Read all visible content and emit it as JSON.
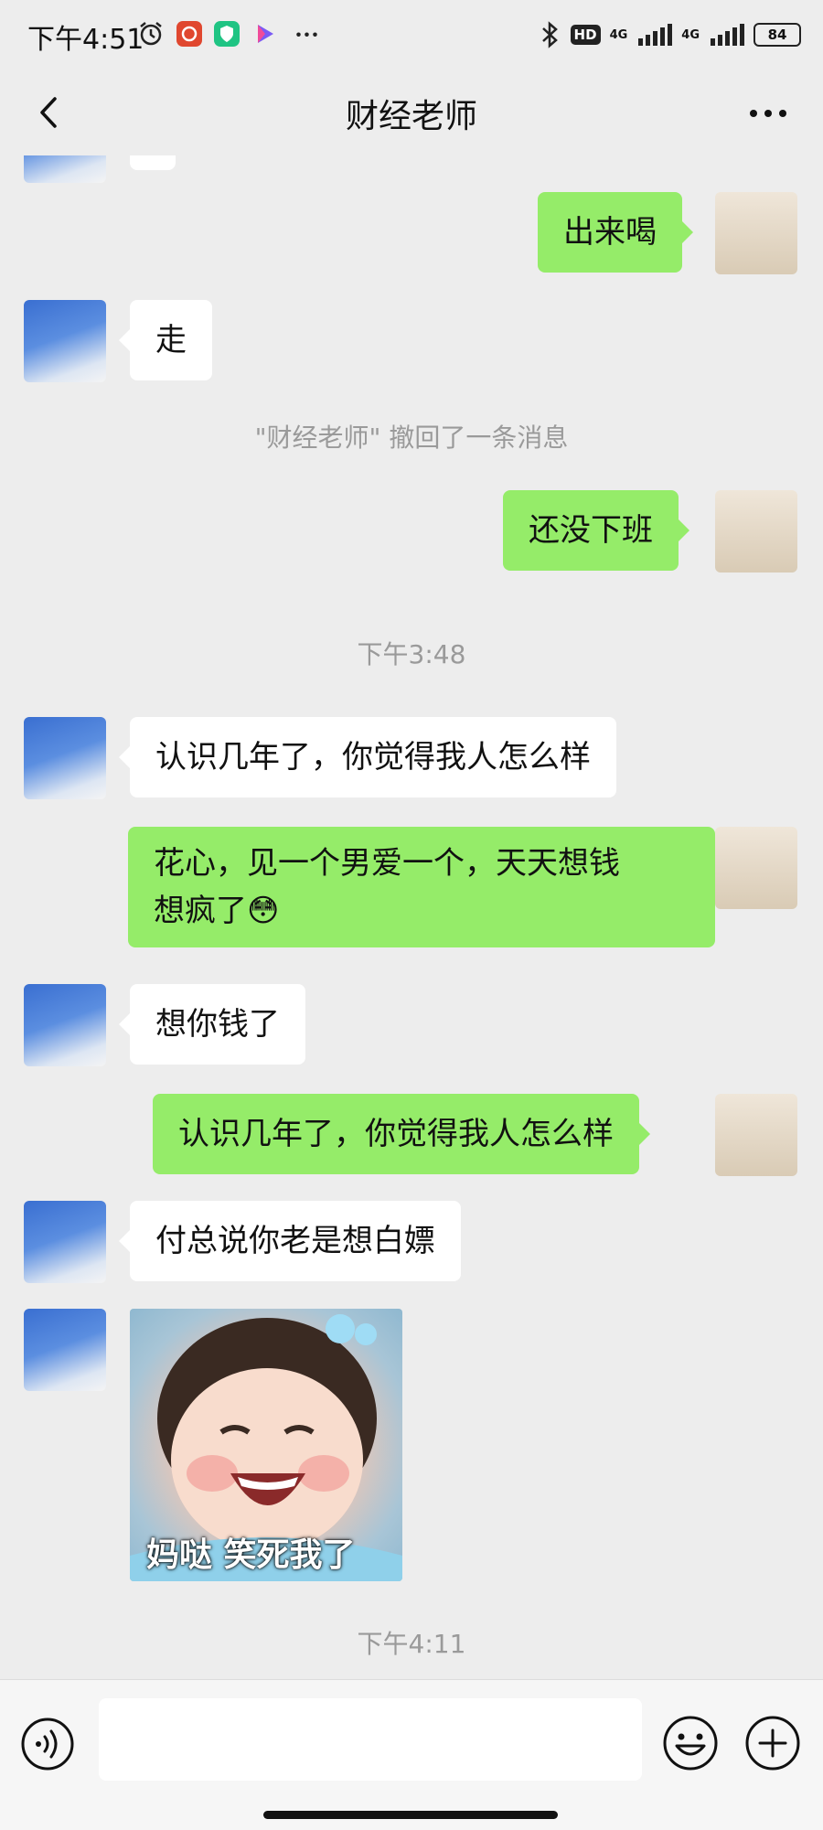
{
  "status_bar": {
    "time": "下午4:51",
    "network_1": "4G",
    "network_2": "4G",
    "hd_label": "HD",
    "battery": "84"
  },
  "header": {
    "title": "财经老师",
    "back_icon": "chevron-left-icon",
    "more_icon": "more-dots-icon"
  },
  "messages": [
    {
      "side": "right",
      "text": "出来喝"
    },
    {
      "side": "left",
      "text": "走"
    },
    {
      "system": "\"财经老师\" 撤回了一条消息"
    },
    {
      "side": "right",
      "text": "还没下班"
    },
    {
      "timestamp": "下午3:48"
    },
    {
      "side": "left",
      "text": "认识几年了，你觉得我人怎么样"
    },
    {
      "side": "right",
      "text_line1": "花心，见一个男爱一个，天天想钱",
      "text_line2": "想疯了",
      "emoji": "😳"
    },
    {
      "side": "left",
      "text": "想你钱了"
    },
    {
      "side": "right",
      "text": "认识几年了，你觉得我人怎么样"
    },
    {
      "side": "left",
      "text": "付总说你老是想白嫖"
    },
    {
      "side": "left",
      "sticker_caption": "妈哒 笑死我了"
    },
    {
      "timestamp": "下午4:11"
    }
  ],
  "input_bar": {
    "voice_icon": "voice-icon",
    "emoji_icon": "emoji-icon",
    "plus_icon": "plus-icon",
    "input_value": ""
  },
  "colors": {
    "background": "#ededed",
    "bubble_self": "#95ec69",
    "bubble_other": "#ffffff"
  }
}
